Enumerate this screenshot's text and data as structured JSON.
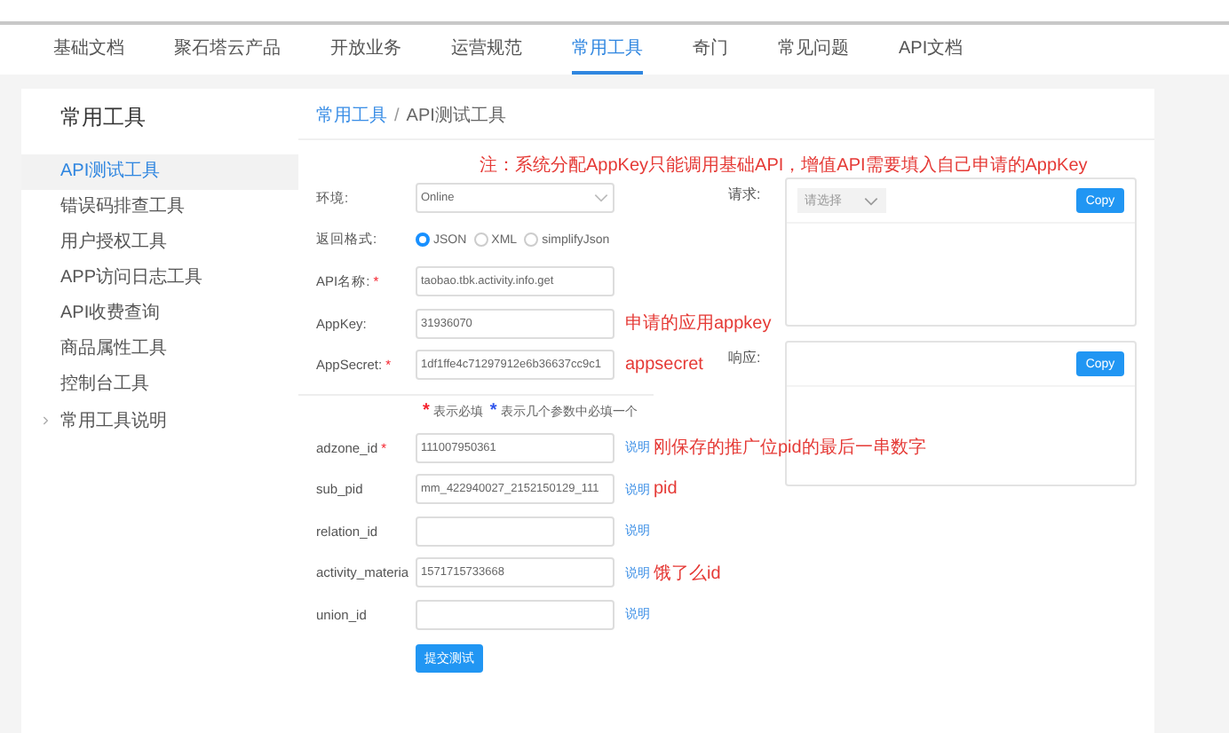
{
  "nav": [
    {
      "label": "基础文档",
      "selected": false
    },
    {
      "label": "聚石塔云产品",
      "selected": false
    },
    {
      "label": "开放业务",
      "selected": false
    },
    {
      "label": "运营规范",
      "selected": false
    },
    {
      "label": "常用工具",
      "selected": true
    },
    {
      "label": "奇门",
      "selected": false
    },
    {
      "label": "常见问题",
      "selected": false
    },
    {
      "label": "API文档",
      "selected": false
    }
  ],
  "sidebar": {
    "title": "常用工具",
    "items": [
      {
        "label": "API测试工具",
        "selected": true,
        "kind": "item"
      },
      {
        "label": "错误码排查工具",
        "selected": false,
        "kind": "item"
      },
      {
        "label": "用户授权工具",
        "selected": false,
        "kind": "item"
      },
      {
        "label": "APP访问日志工具",
        "selected": false,
        "kind": "item"
      },
      {
        "label": "API收费查询",
        "selected": false,
        "kind": "item"
      },
      {
        "label": "商品属性工具",
        "selected": false,
        "kind": "item"
      },
      {
        "label": "控制台工具",
        "selected": false,
        "kind": "item"
      },
      {
        "label": "常用工具说明",
        "selected": false,
        "kind": "group"
      }
    ]
  },
  "breadcrumb": [
    "常用工具",
    "API测试工具"
  ],
  "breadcrumb_separator": "/",
  "note": "注：系统分配AppKey只能调用基础API，增值API需要填入自己申请的AppKey",
  "required_mark": "*",
  "settings": [
    {
      "kind": "select",
      "label": "环境:",
      "value": "Online"
    },
    {
      "kind": "radio",
      "label": "返回格式:",
      "options": [
        {
          "label": "JSON",
          "selected": true
        },
        {
          "label": "XML",
          "selected": false
        },
        {
          "label": "simplifyJson",
          "selected": false
        }
      ]
    },
    {
      "kind": "input",
      "label": "API名称:",
      "required": true,
      "value": "taobao.tbk.activity.info.get"
    },
    {
      "kind": "input",
      "label": "AppKey:",
      "required": false,
      "value": "31936070",
      "annotation": "申请的应用appkey"
    },
    {
      "kind": "input",
      "label": "AppSecret:",
      "required": true,
      "value": "1df1ffe4c71297912e6b36637cc9c1",
      "annotation": "appsecret"
    }
  ],
  "legend": [
    {
      "mark": "*",
      "color": "#f5222d",
      "text": "表示必填"
    },
    {
      "mark": "*",
      "color": "#2f54eb",
      "text": "表示几个参数中必填一个"
    }
  ],
  "params": [
    {
      "label": "adzone_id",
      "required": true,
      "value": "111007950361",
      "link": "说明",
      "annotation": "刚保存的推广位pid的最后一串数字"
    },
    {
      "label": "sub_pid",
      "required": false,
      "value": "mm_422940027_2152150129_111",
      "link": "说明",
      "annotation": "pid"
    },
    {
      "label": "relation_id",
      "required": false,
      "link": "说明"
    },
    {
      "label": "activity_materia",
      "required": false,
      "value": "1571715733668",
      "link": "说明",
      "annotation": "饿了么id"
    },
    {
      "label": "union_id",
      "required": false,
      "link": "说明"
    }
  ],
  "submit": "提交测试",
  "request": {
    "label": "请求:",
    "placeholder": "请选择",
    "copy": "Copy"
  },
  "response": {
    "label": "响应:",
    "copy": "Copy"
  }
}
